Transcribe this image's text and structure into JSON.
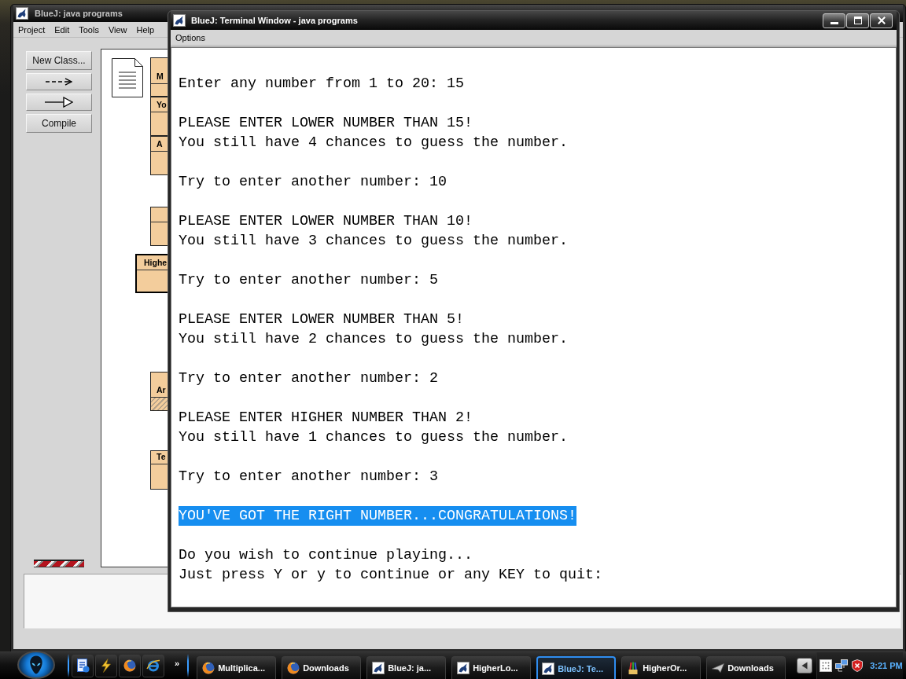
{
  "main_window": {
    "title": "BlueJ: java programs",
    "menu": [
      "Project",
      "Edit",
      "Tools",
      "View",
      "Help"
    ],
    "tools": [
      {
        "kind": "text",
        "label": "New Class..."
      },
      {
        "kind": "dashed-arrow"
      },
      {
        "kind": "solid-arrow"
      },
      {
        "kind": "text",
        "label": "Compile"
      }
    ],
    "classes": [
      {
        "name": "M",
        "compiled": true,
        "selected": false
      },
      {
        "name": "Yo",
        "compiled": true,
        "selected": false
      },
      {
        "name": "A",
        "compiled": true,
        "selected": false
      },
      {
        "compiled": true,
        "selected": false
      },
      {
        "name": "Highe",
        "compiled": true,
        "selected": true
      },
      {
        "name": "Ar",
        "compiled": false,
        "selected": false
      },
      {
        "name": "Te",
        "compiled": true,
        "selected": false
      }
    ],
    "vm_running": true
  },
  "terminal": {
    "title": "BlueJ: Terminal Window - java programs",
    "menu": [
      "Options"
    ],
    "output": [
      {
        "lines": [
          {
            "text": "Enter any number from 1 to 20: 15",
            "selected": false
          }
        ]
      },
      {
        "lines": [
          {
            "text": "PLEASE ENTER LOWER NUMBER THAN 15!",
            "selected": false
          },
          {
            "text": "You still have 4 chances to guess the number.",
            "selected": false
          }
        ]
      },
      {
        "lines": [
          {
            "text": "Try to enter another number: 10",
            "selected": false
          }
        ]
      },
      {
        "lines": [
          {
            "text": "PLEASE ENTER LOWER NUMBER THAN 10!",
            "selected": false
          },
          {
            "text": "You still have 3 chances to guess the number.",
            "selected": false
          }
        ]
      },
      {
        "lines": [
          {
            "text": "Try to enter another number: 5",
            "selected": false
          }
        ]
      },
      {
        "lines": [
          {
            "text": "PLEASE ENTER LOWER NUMBER THAN 5!",
            "selected": false
          },
          {
            "text": "You still have 2 chances to guess the number.",
            "selected": false
          }
        ]
      },
      {
        "lines": [
          {
            "text": "Try to enter another number: 2",
            "selected": false
          }
        ]
      },
      {
        "lines": [
          {
            "text": "PLEASE ENTER HIGHER NUMBER THAN 2!",
            "selected": false
          },
          {
            "text": "You still have 1 chances to guess the number.",
            "selected": false
          }
        ]
      },
      {
        "lines": [
          {
            "text": "Try to enter another number: 3",
            "selected": false
          }
        ]
      },
      {
        "lines": [
          {
            "text": "YOU'VE GOT THE RIGHT NUMBER...CONGRATULATIONS!",
            "selected": true
          }
        ]
      },
      {
        "lines": [
          {
            "text": "Do you wish to continue playing...",
            "selected": false
          },
          {
            "text": "Just press Y or y to continue or any KEY to quit:",
            "selected": false
          }
        ]
      }
    ]
  },
  "taskbar": {
    "quick_launch": [
      {
        "kind": "page"
      },
      {
        "kind": "bolt"
      },
      {
        "kind": "firefox"
      },
      {
        "kind": "ie"
      }
    ],
    "more": "»",
    "buttons": [
      {
        "label": "Multiplica...",
        "kind": "firefox",
        "selected": false
      },
      {
        "label": "Downloads",
        "kind": "firefox",
        "selected": false
      },
      {
        "label": "BlueJ: ja...",
        "kind": "bluej",
        "selected": false
      },
      {
        "label": "HigherLo...",
        "kind": "bluej",
        "selected": false
      },
      {
        "label": "BlueJ: Te...",
        "kind": "bluej",
        "selected": true
      },
      {
        "label": "HigherOr...",
        "kind": "brushes",
        "selected": false
      },
      {
        "label": "Downloads",
        "kind": "download",
        "selected": false
      }
    ],
    "tray": [
      {
        "kind": "grid"
      },
      {
        "kind": "network"
      },
      {
        "kind": "shield"
      }
    ],
    "clock": "3:21 PM"
  }
}
